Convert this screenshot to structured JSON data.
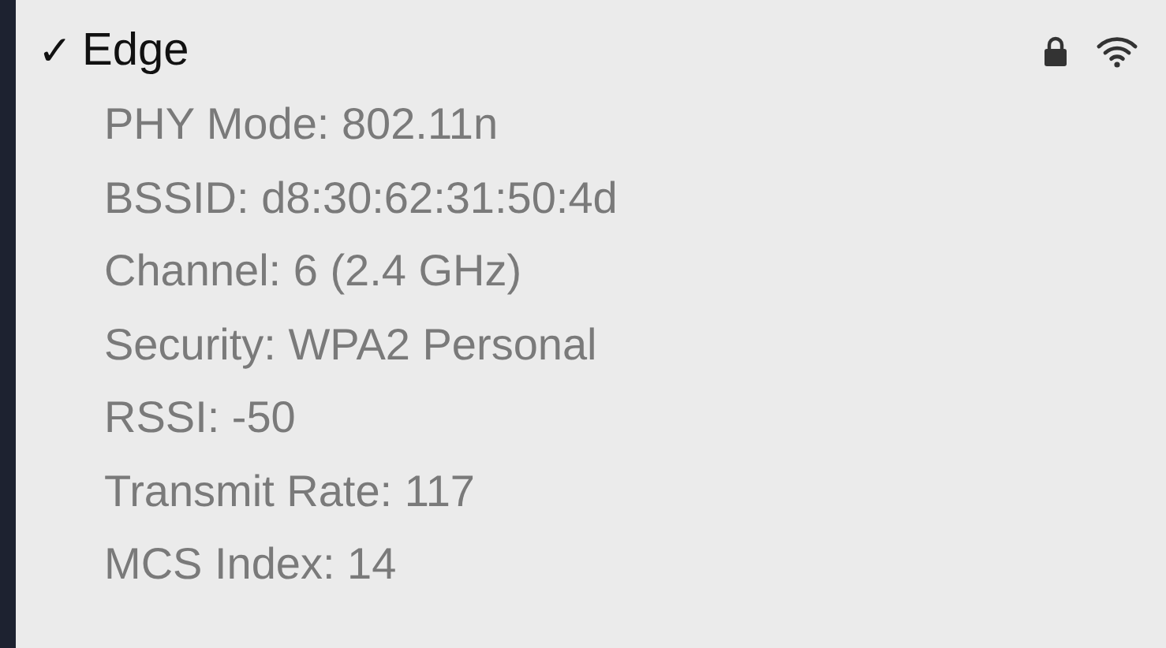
{
  "network": {
    "name": "Edge",
    "checked": true,
    "check_mark": "✓",
    "locked": true
  },
  "details": [
    "PHY Mode: 802.11n",
    "BSSID: d8:30:62:31:50:4d",
    "Channel: 6 (2.4 GHz)",
    "Security: WPA2 Personal",
    "RSSI: -50",
    "Transmit Rate: 117",
    "MCS Index: 14"
  ]
}
